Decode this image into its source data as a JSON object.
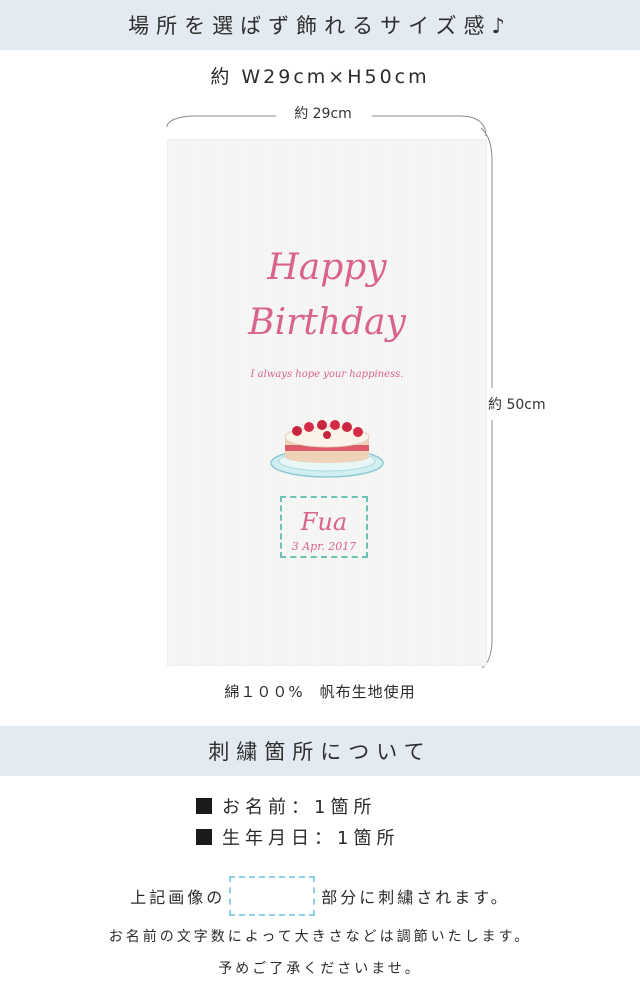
{
  "header": {
    "title": "場所を選ばず飾れるサイズ感♪"
  },
  "size": {
    "overall": "約 W29cm×H50cm",
    "width": "約 29cm",
    "height": "約 50cm",
    "material": "綿１００%　帆布生地使用"
  },
  "tapestry": {
    "line1": "Happy",
    "line2": "Birthday",
    "tagline": "I always hope your happiness.",
    "name": "Fua",
    "date": "3 Apr. 2017"
  },
  "embroidery": {
    "title": "刺繍箇所について",
    "items": [
      "お名前：1箇所",
      "生年月日：1箇所"
    ]
  },
  "notes": {
    "line1_before": "上記画像の",
    "line1_after": "部分に刺繍されます。",
    "line2": "お名前の文字数によって大きさなどは調節いたします。",
    "line3": "予めご了承くださいませ。"
  },
  "colors": {
    "banner": "#e3eaf2",
    "embroidery_pink": "#d9628f",
    "dashed_box": "#6cc2b4"
  }
}
